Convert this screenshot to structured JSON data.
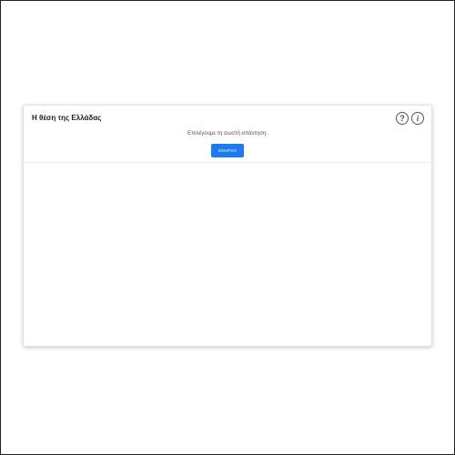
{
  "quiz": {
    "title": "Η θέση της Ελλάδας",
    "instruction": "Επιλέγουμε τη σωστή απάντηση.",
    "start_label": "ΕΝΑΡΞΗ",
    "help_icon": "help-circle-icon",
    "help_glyph": "?",
    "info_icon": "info-circle-icon",
    "info_glyph": "i"
  },
  "colors": {
    "accent": "#1e7bef",
    "title_text": "#222222",
    "icon_stroke": "#555555"
  }
}
